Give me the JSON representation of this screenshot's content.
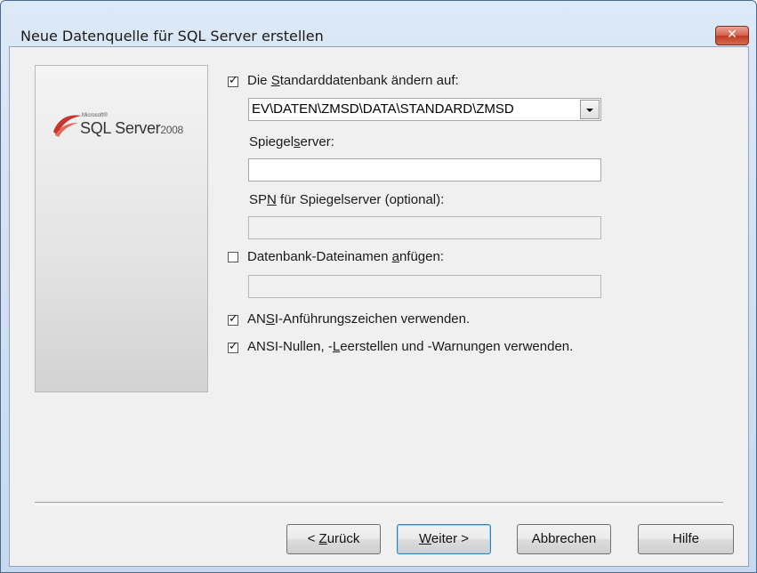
{
  "window": {
    "title": "Neue Datenquelle für SQL Server erstellen",
    "close_glyph": "✕"
  },
  "logo": {
    "brand": "Microsoft®",
    "product": "SQL Server",
    "year": "2008"
  },
  "options": {
    "change_default_db": {
      "checked": true,
      "label_pre": "Die ",
      "label_mnemonic": "S",
      "label_post": "tandarddatenbank ändern auf:",
      "value": "EV\\DATEN\\ZMSD\\DATA\\STANDARD\\ZMSD"
    },
    "mirror_server": {
      "label_pre": "Spiegel",
      "label_mnemonic": "s",
      "label_post": "erver:",
      "value": ""
    },
    "spn": {
      "label_pre": "SP",
      "label_mnemonic": "N",
      "label_post": " für Spiegelserver (optional):",
      "value": ""
    },
    "attach_db": {
      "checked": false,
      "label_pre": "Datenbank-Dateinamen ",
      "label_mnemonic": "a",
      "label_post": "nfügen:",
      "value": ""
    },
    "ansi_quotes": {
      "checked": true,
      "label_pre": "AN",
      "label_mnemonic": "S",
      "label_post": "I-Anführungszeichen verwenden."
    },
    "ansi_nulls": {
      "checked": true,
      "label_pre": "ANSI-Nullen, -",
      "label_mnemonic": "L",
      "label_post": "eerstellen und -Warnungen verwenden."
    }
  },
  "buttons": {
    "back": {
      "pre": "< ",
      "mnemonic": "Z",
      "post": "urück"
    },
    "next": {
      "pre": "",
      "mnemonic": "W",
      "post": "eiter >"
    },
    "cancel": "Abbrechen",
    "help": "Hilfe"
  },
  "icons": {
    "checkmark": "✓",
    "dropdown": "chevron-down-icon",
    "close": "close-icon",
    "logo": "sql-server-logo-icon"
  }
}
